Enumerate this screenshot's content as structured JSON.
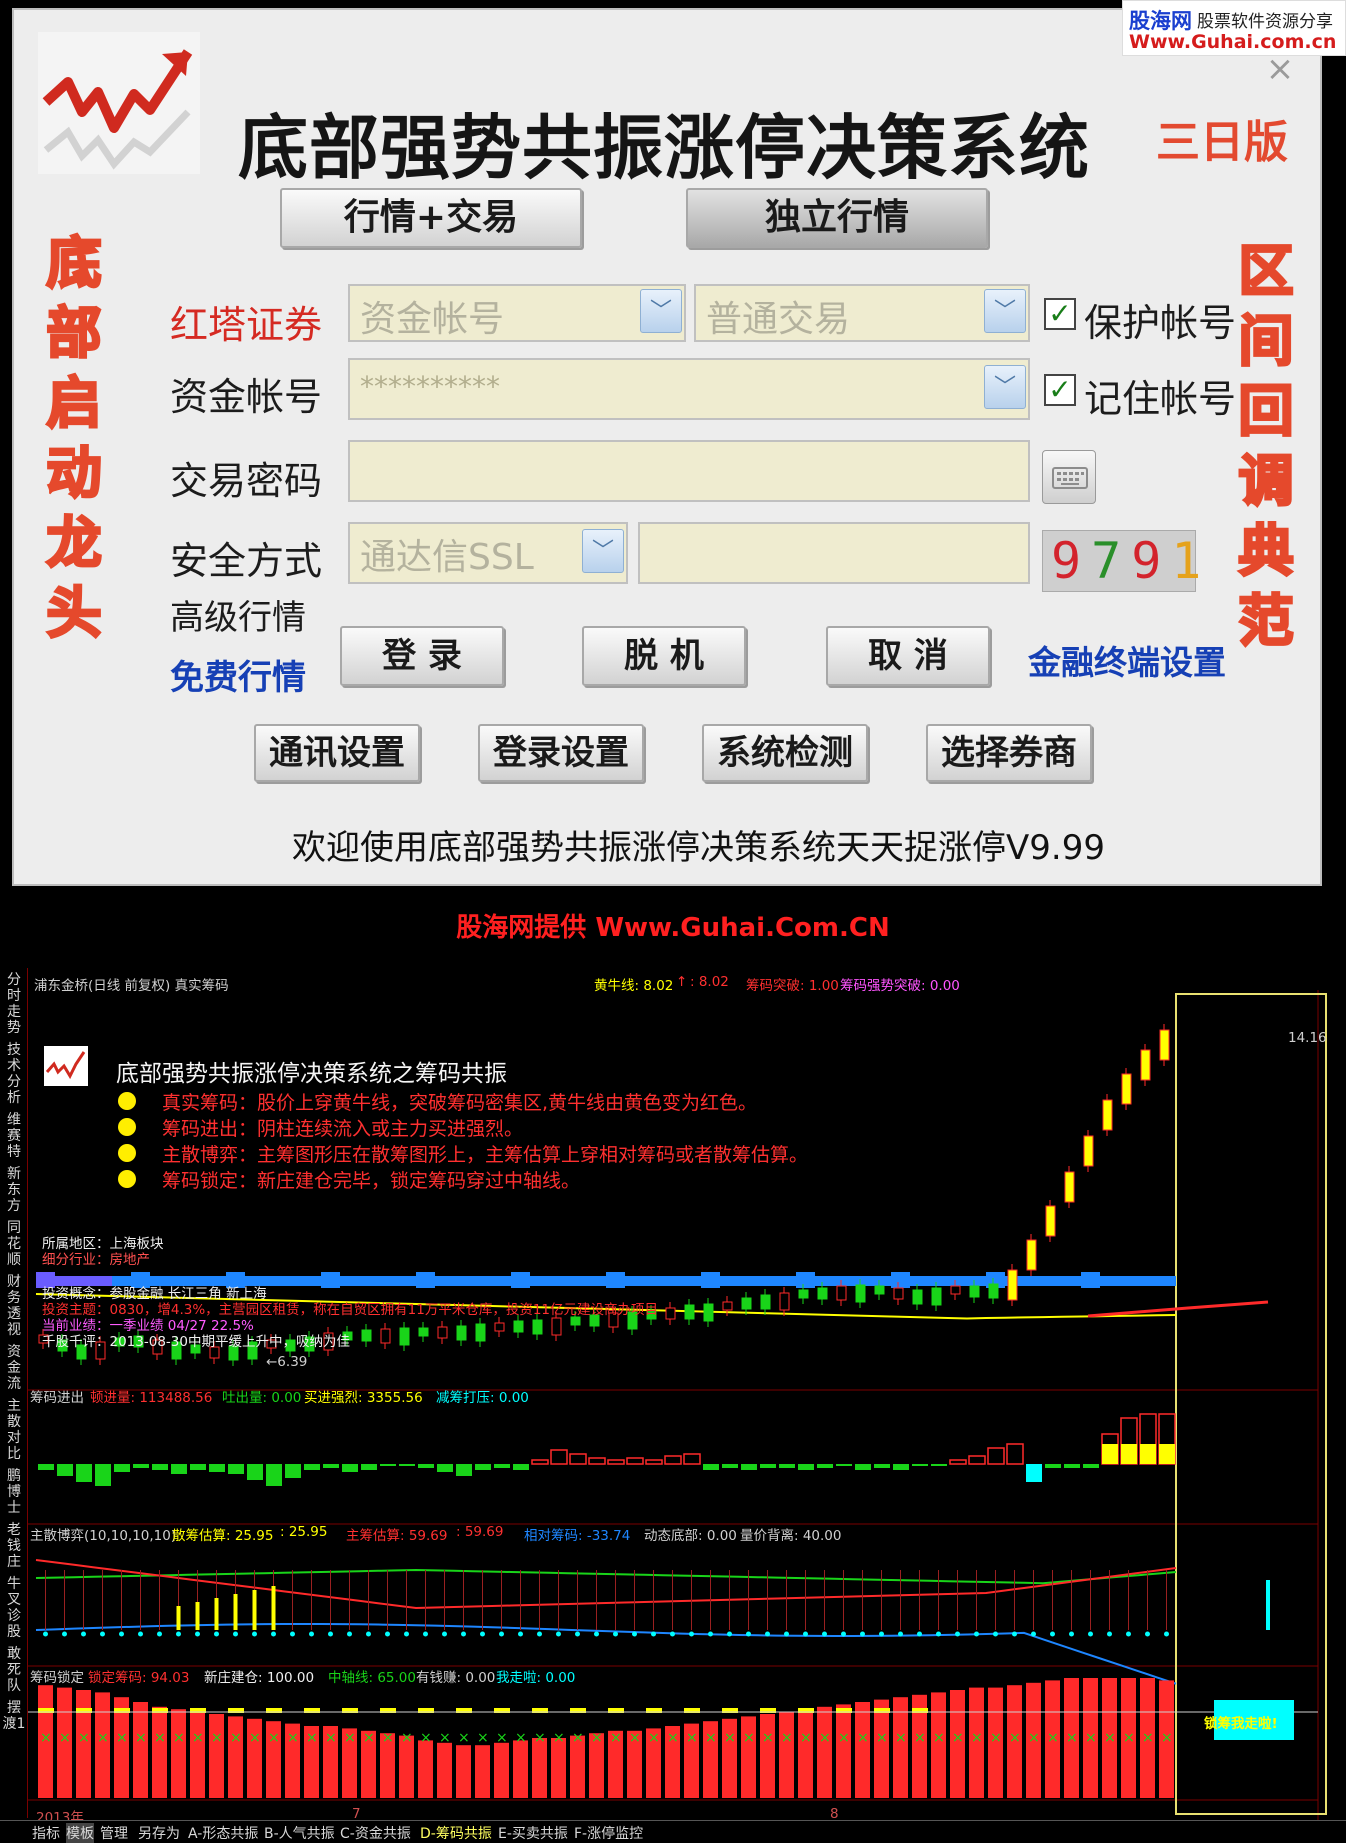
{
  "watermark": {
    "brand": "股海网",
    "tagline": "股票软件资源分享",
    "url": "Www.Guhai.com.cn"
  },
  "dialog": {
    "title": "底部强势共振涨停决策系统",
    "edition": "三日版",
    "left_vertical": [
      "底",
      "部",
      "启",
      "动",
      "龙",
      "头"
    ],
    "right_vertical": [
      "区",
      "间",
      "回",
      "调",
      "典",
      "范"
    ],
    "mode_buttons": {
      "quote_trade": "行情+交易",
      "standalone": "独立行情"
    },
    "broker": {
      "label": "红塔证券",
      "account_type": "资金帐号",
      "trade_type": "普通交易",
      "protect_label": "保护帐号"
    },
    "account": {
      "label": "资金帐号",
      "value": "**********",
      "remember_label": "记住帐号"
    },
    "password": {
      "label": "交易密码",
      "value": ""
    },
    "security": {
      "label": "安全方式",
      "method": "通达信SSL",
      "code_value": "",
      "captcha": "9791"
    },
    "advanced_label": "高级行情",
    "free_label": "免费行情",
    "actions": {
      "login": "登 录",
      "offline": "脱 机",
      "cancel": "取 消",
      "terminal_settings": "金融终端设置"
    },
    "settings_buttons": [
      "通讯设置",
      "登录设置",
      "系统检测",
      "选择券商"
    ],
    "welcome": "欢迎使用底部强势共振涨停决策系统天天捉涨停V9.99"
  },
  "banner": "股海网提供 Www.Guhai.Com.CN",
  "chart": {
    "side_tabs": [
      "分时走势",
      "技术分析",
      "维赛特",
      "新东方",
      "同花顺",
      "财务透视",
      "资金流",
      "主散对比",
      "鹏博士",
      "老钱庄",
      "牛叉诊股",
      "敢死队",
      "摆渡1"
    ],
    "bottom_tabs": [
      "指标",
      "模板",
      "管理",
      "另存为",
      "A-形态共振",
      "B-人气共振",
      "C-资金共振",
      "D-筹码共振",
      "E-买卖共振",
      "F-涨停监控"
    ],
    "header": {
      "stock": "浦东金桥(日线 前复权) 真实筹码",
      "yellow_bull": "黄牛线: 8.02",
      "yellow_bull2": ": 8.02",
      "breakout": "筹码突破: 1.00",
      "strong_breakout": "筹码强势突破: 0.00"
    },
    "annotation": {
      "title": "底部强势共振涨停决策系统之筹码共振",
      "items": [
        {
          "k": "真实筹码：",
          "v": "股价上穿黄牛线，突破筹码密集区,黄牛线由黄色变为红色。"
        },
        {
          "k": "筹码进出：",
          "v": "阴柱连续流入或主力买进强烈。"
        },
        {
          "k": "主散博弈：",
          "v": "主筹图形压在散筹图形上，主筹估算上穿相对筹码或者散筹估算。"
        },
        {
          "k": "筹码锁定：",
          "v": "新庄建仓完毕，锁定筹码穿过中轴线。"
        }
      ]
    },
    "info": {
      "region": "所属地区：上海板块",
      "industry": "细分行业：房地产",
      "concept": "投资概念：参股金融 长江三角 新上海",
      "theme": "投资主题：0830，增4.3%，主营园区租赁，称在自贸区拥有11万平米仓库，投资11亿元建设商办项目",
      "perf": "当前业绩：一季业绩 04/27 22.5%",
      "review": "千股千评：2013-08-30中期平缓上升中，吸纳为佳",
      "low": "←6.39",
      "high": "14.16"
    },
    "p2": {
      "name": "筹码进出",
      "a": "顿进量: 113488.56",
      "b": "吐出量: 0.00",
      "c": "买进强烈: 3355.56",
      "d": "减筹打压: 0.00"
    },
    "p3": {
      "name": "主散博弈(10,10,10,10)",
      "a": "散筹估算: 25.95",
      "a2": ": 25.95",
      "b": "主筹估算: 59.69",
      "b2": ": 59.69",
      "c": "相对筹码: -33.74",
      "d": "动态底部: 0.00",
      "e": "量价背离: 40.00"
    },
    "p4": {
      "name": "筹码锁定",
      "a": "锁定筹码: 94.03",
      "b": "新庄建仓: 100.00",
      "c": "中轴线: 65.00",
      "d": "有钱赚: 0.00",
      "e": "我走啦: 0.00",
      "tag": "锁筹我走啦!"
    },
    "xaxis": {
      "year": "2013年",
      "m7": "7",
      "m8": "8"
    },
    "colors": {
      "up": "#ff2a2a",
      "down": "#19d419",
      "yellow": "#ffff00",
      "cyan": "#00ffff",
      "blue": "#1e86ff",
      "magenta": "#ff55ff"
    },
    "chart_data": {
      "type": "bar",
      "title": "",
      "categories": [],
      "series": [
        {
          "name": "锁定筹码",
          "values": [
            94,
            92,
            90,
            88,
            84,
            80,
            76,
            74,
            72,
            70,
            68,
            66,
            64,
            62,
            60,
            60,
            58,
            56,
            54,
            52,
            48,
            46,
            44,
            44,
            46,
            48,
            50,
            50,
            52,
            54,
            56,
            56,
            58,
            60,
            62,
            64,
            66,
            68,
            70,
            72,
            74,
            76,
            78,
            80,
            82,
            84,
            86,
            88,
            90,
            92,
            92,
            94,
            96,
            98,
            100,
            100,
            100,
            100,
            100,
            98
          ]
        }
      ]
    }
  }
}
